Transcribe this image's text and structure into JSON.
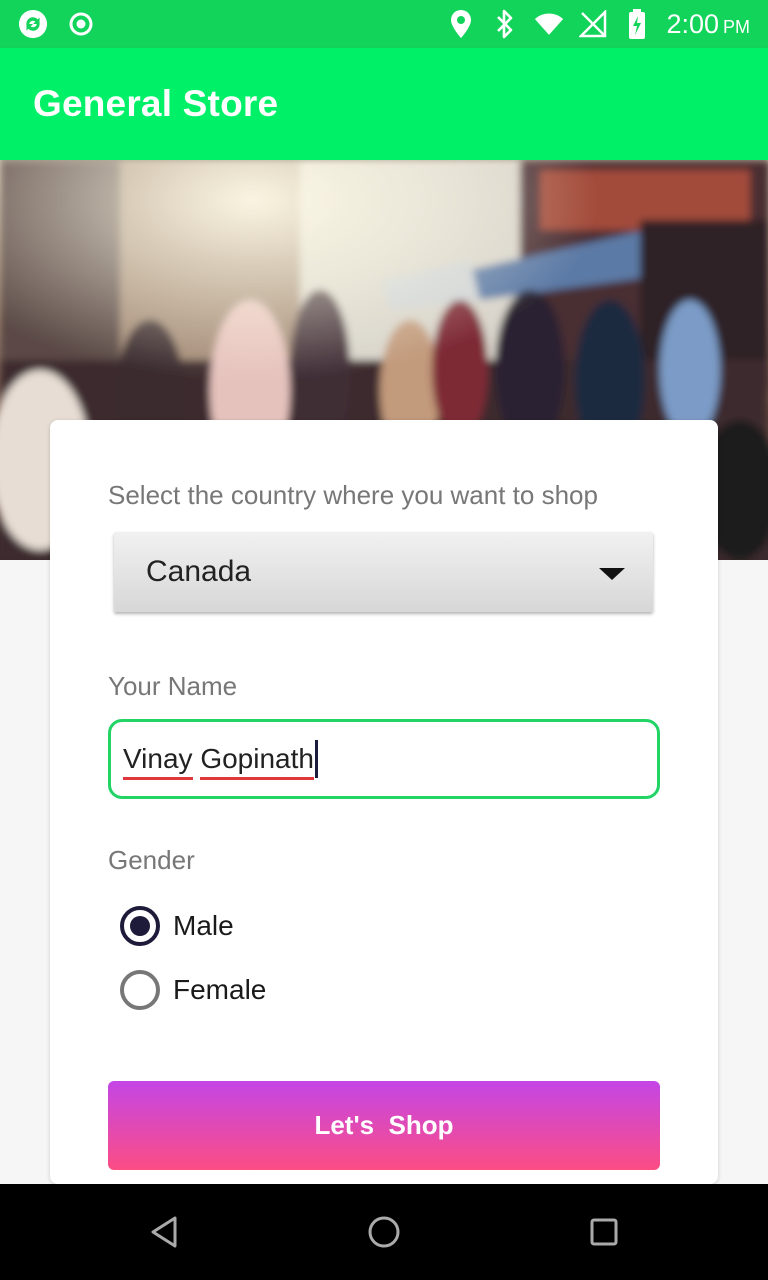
{
  "status_bar": {
    "time": "2:00",
    "ampm": "PM",
    "icons": [
      "sync-icon",
      "record-icon",
      "location-icon",
      "bluetooth-icon",
      "wifi-icon",
      "no-signal-icon",
      "battery-charging-icon"
    ]
  },
  "app_bar": {
    "title": "General Store"
  },
  "hero": {
    "description_icon": "shopping-street-photo"
  },
  "form": {
    "country_label": "Select the country where you want to shop",
    "country_selected": "Canada",
    "name_label": "Your Name",
    "name_value_first": "Vinay",
    "name_value_last": "Gopinath",
    "gender_label": "Gender",
    "gender_options": [
      "Male",
      "Female"
    ],
    "gender_selected": "Male",
    "submit_label": "Let's  Shop"
  },
  "colors": {
    "status_bar": "#13d45a",
    "app_bar": "#00f068",
    "input_border": "#22d465",
    "button_top": "#c446e6",
    "button_bottom": "#fc4d84",
    "radio_checked": "#1e1b3a"
  },
  "nav_bar": {
    "buttons": [
      "back-icon",
      "home-icon",
      "recents-icon"
    ]
  }
}
